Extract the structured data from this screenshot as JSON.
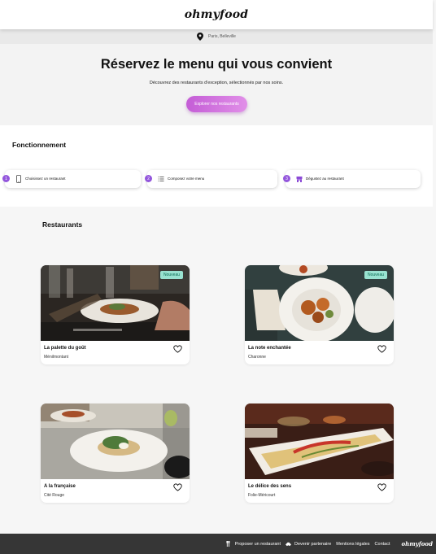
{
  "header": {
    "logo": "ohmyfood"
  },
  "location": {
    "text": "Paris, Belleville"
  },
  "hero": {
    "title": "Réservez le menu qui vous convient",
    "subtitle": "Découvrez des restaurants d'exception, sélectionnés par nos soins.",
    "cta": "Explorer nos restaurants"
  },
  "how": {
    "title": "Fonctionnement",
    "steps": [
      {
        "num": "1",
        "label": "Choisissez un restaurant",
        "icon": "phone-icon"
      },
      {
        "num": "2",
        "label": "Composez votre menu",
        "icon": "list-icon"
      },
      {
        "num": "3",
        "label": "Dégustez au restaurant",
        "icon": "store-icon"
      }
    ]
  },
  "restaurants": {
    "title": "Restaurants",
    "items": [
      {
        "name": "La palette du goût",
        "area": "Ménilmontant",
        "badge": "Nouveau"
      },
      {
        "name": "La note enchantée",
        "area": "Charonne",
        "badge": "Nouveau"
      },
      {
        "name": "A la française",
        "area": "Cité Rouge"
      },
      {
        "name": "Le délice des sens",
        "area": "Folie-Méricourt"
      }
    ]
  },
  "footer": {
    "links": [
      "Proposer un restaurant",
      "Devenir partenaire",
      "Mentions légales",
      "Contact"
    ],
    "logo": "ohmyfood"
  },
  "colors": {
    "accent": "#9356dc",
    "cta": "#d275e0",
    "badge": "#99e2d0",
    "footer": "#363636"
  }
}
